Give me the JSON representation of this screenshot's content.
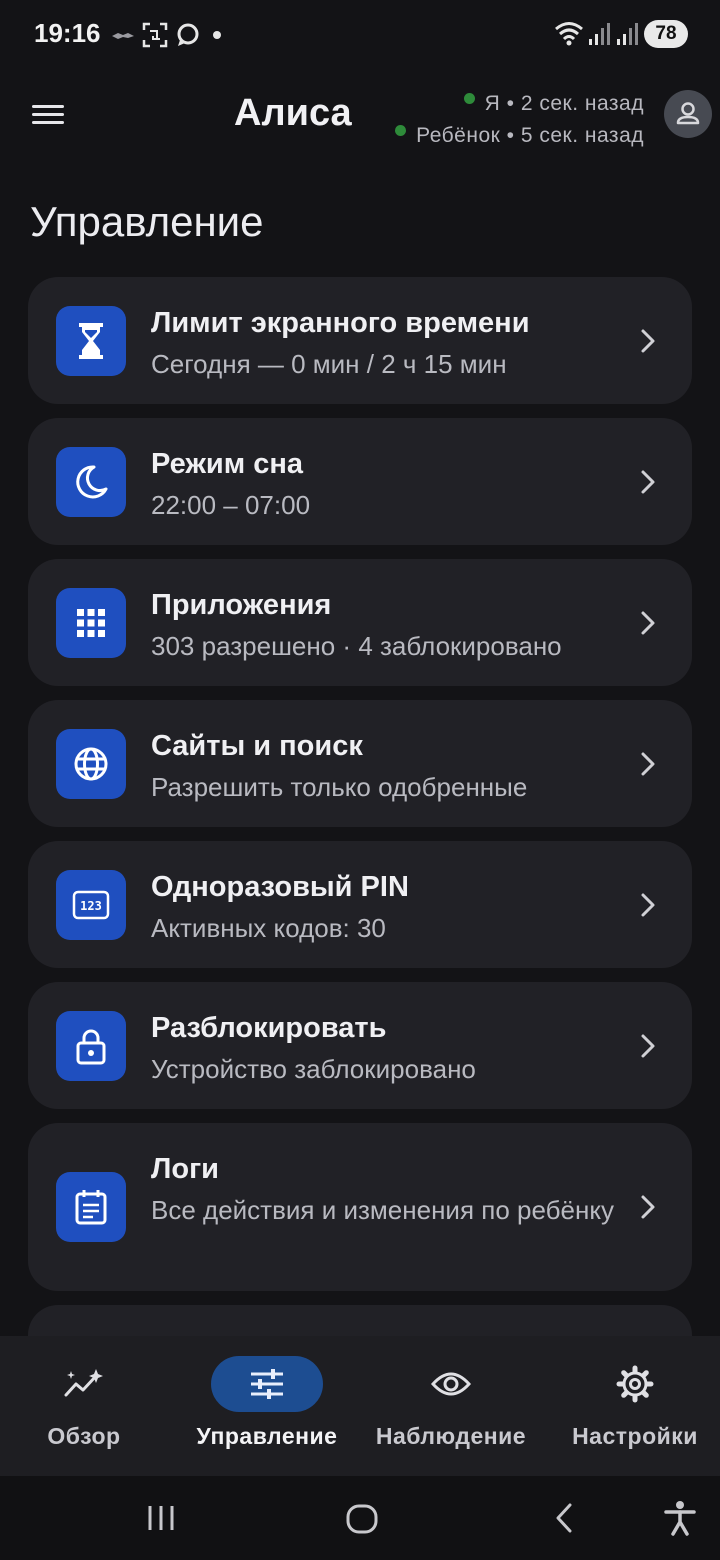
{
  "status_bar": {
    "time": "19:16",
    "battery": "78",
    "icons": [
      "bat-icon",
      "screenshot-icon",
      "chat-bubble-icon",
      "dot-icon",
      "wifi-icon",
      "signal-icon",
      "signal-icon"
    ]
  },
  "header": {
    "child_name": "Алиса",
    "presence_me": "Я • 2 сек. назад",
    "presence_child": "Ребёнок • 5 сек. назад",
    "online_color": "#2e8b3a"
  },
  "page_title": "Управление",
  "cards": [
    {
      "title": "Лимит экранного времени",
      "subtitle": "Сегодня — 0 мин / 2 ч 15 мин",
      "icon": "hourglass-icon"
    },
    {
      "title": "Режим сна",
      "subtitle": "22:00 – 07:00",
      "icon": "moon-icon"
    },
    {
      "title": "Приложения",
      "subtitle": "303 разрешено · 4 заблокировано",
      "icon": "apps-grid-icon"
    },
    {
      "title": "Сайты и поиск",
      "subtitle": "Разрешить только одобренные",
      "icon": "globe-icon"
    },
    {
      "title": "Одноразовый PIN",
      "subtitle": "Активных кодов: 30",
      "icon": "pin-123-icon"
    },
    {
      "title": "Разблокировать",
      "subtitle": "Устройство заблокировано",
      "icon": "lock-icon"
    },
    {
      "title": "Логи",
      "subtitle": "Все действия и изменения по ребёнку",
      "icon": "log-calendar-icon"
    }
  ],
  "bottom_nav": [
    {
      "label": "Обзор",
      "icon": "sparkle-chart-icon",
      "active": false
    },
    {
      "label": "Управление",
      "icon": "sliders-icon",
      "active": true
    },
    {
      "label": "Наблюдение",
      "icon": "eye-icon",
      "active": false
    },
    {
      "label": "Настройки",
      "icon": "gear-icon",
      "active": false
    }
  ],
  "colors": {
    "background": "#131316",
    "card": "#212126",
    "accent_icon": "#1f4fbf",
    "active_pill": "#1d4d91"
  }
}
